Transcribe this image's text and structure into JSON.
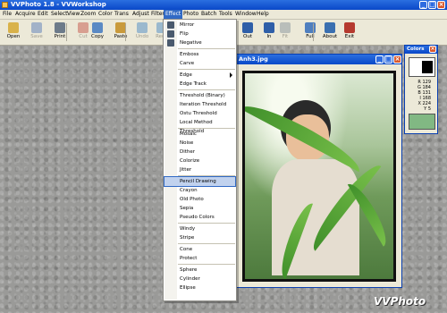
{
  "app": {
    "title": "VVPhoto 1.8  -  VVWorkshop",
    "watermark": "VVPhoto"
  },
  "menubar": {
    "items": [
      "File",
      "Acquire",
      "Edit",
      "Select",
      "View",
      "Zoom",
      "Color",
      "Trans",
      "Adjust",
      "Filter",
      "Effect",
      "Photo",
      "Batch",
      "Tools",
      "Window",
      "Help"
    ],
    "active": "Effect"
  },
  "toolbar": {
    "buttons": [
      {
        "label": "Open",
        "icon": "open-folder-icon",
        "enabled": true
      },
      {
        "label": "Save",
        "icon": "save-disk-icon",
        "enabled": false
      },
      {
        "label": "Print",
        "icon": "printer-icon",
        "enabled": true
      },
      {
        "label": "Cut",
        "icon": "scissors-icon",
        "enabled": false
      },
      {
        "label": "Copy",
        "icon": "copy-icon",
        "enabled": true
      },
      {
        "label": "Paste",
        "icon": "paste-icon",
        "enabled": true
      },
      {
        "label": "Undo",
        "icon": "undo-icon",
        "enabled": false
      },
      {
        "label": "Redo",
        "icon": "redo-icon",
        "enabled": false
      },
      {
        "label": "Out",
        "icon": "zoom-out-icon",
        "enabled": true
      },
      {
        "label": "In",
        "icon": "zoom-in-icon",
        "enabled": true
      },
      {
        "label": "Fit",
        "icon": "fit-icon",
        "enabled": false
      },
      {
        "label": "Full",
        "icon": "fullscreen-icon",
        "enabled": true
      },
      {
        "label": "About",
        "icon": "help-icon",
        "enabled": true
      },
      {
        "label": "Exit",
        "icon": "exit-icon",
        "enabled": true
      }
    ]
  },
  "effect_menu": {
    "groups": [
      [
        "Mirror",
        "Flip",
        "Negative"
      ],
      [
        "Emboss",
        "Carve"
      ],
      [
        "Edge",
        "Edge Track"
      ],
      [
        "Threshold (Binary)",
        "Iteration Threshold",
        "Ostu Threshold",
        "Local Method Threshold"
      ],
      [
        "Mosaic",
        "Noise",
        "Dither",
        "Colorize",
        "Jitter"
      ],
      [
        "Pencil Drawing",
        "Crayon",
        "Old Photo",
        "Sepia",
        "Pseudo Colors"
      ],
      [
        "Windy",
        "Stripe"
      ],
      [
        "Cone",
        "Protect"
      ],
      [
        "Sphere",
        "Cylinder",
        "Ellipse"
      ]
    ],
    "highlighted": "Pencil Drawing",
    "submenu_item": "Edge"
  },
  "image_window": {
    "title": "Anh3.jpg"
  },
  "colors_panel": {
    "title": "Colors",
    "values": [
      "R 129",
      "G 184",
      "B 131",
      "I 168",
      "X 224",
      "Y 5"
    ]
  }
}
